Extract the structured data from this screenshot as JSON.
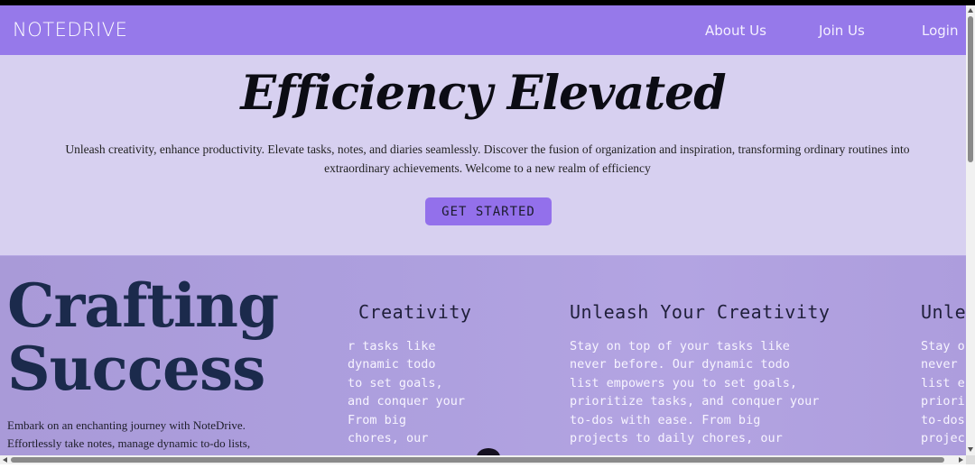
{
  "nav": {
    "brand": "NOTEDRIVE",
    "links": [
      "About Us",
      "Join Us",
      "Login"
    ]
  },
  "hero": {
    "title": "Efficiency Elevated",
    "text_line1": "Unleash creativity, enhance productivity. Elevate tasks, notes, and diaries seamlessly. Discover the fusion of organization and inspiration, transforming ordinary routines into",
    "text_line2": "extraordinary achievements. Welcome to a new realm of efficiency",
    "cta": "GET STARTED"
  },
  "features": {
    "heading_line1": "Crafting",
    "heading_line2": "Success",
    "intro_line1": "Embark on an enchanting journey with NoteDrive.",
    "intro_line2": "Effortlessly take notes, manage dynamic to-do lists,",
    "cards": [
      {
        "title": "Creativity",
        "body": "r tasks like\ndynamic todo\nto set goals,\nand conquer your\nFrom big\nchores, our"
      },
      {
        "title": "Unleash Your Creativity",
        "body": "Stay on top of your tasks like\nnever before. Our dynamic todo\nlist empowers you to set goals,\nprioritize tasks, and conquer your\nto-dos with ease. From big\nprojects to daily chores, our"
      },
      {
        "title": "Unle",
        "body": "Stay o\nnever\nlist e\npriori\nto-dos\nprojec"
      }
    ]
  },
  "colors": {
    "nav_bg": "#9679ea",
    "hero_bg": "#d7d0f0",
    "cta_bg": "#9370eb",
    "features_bg": "#ad9fde",
    "heading": "#1b2a4c"
  }
}
